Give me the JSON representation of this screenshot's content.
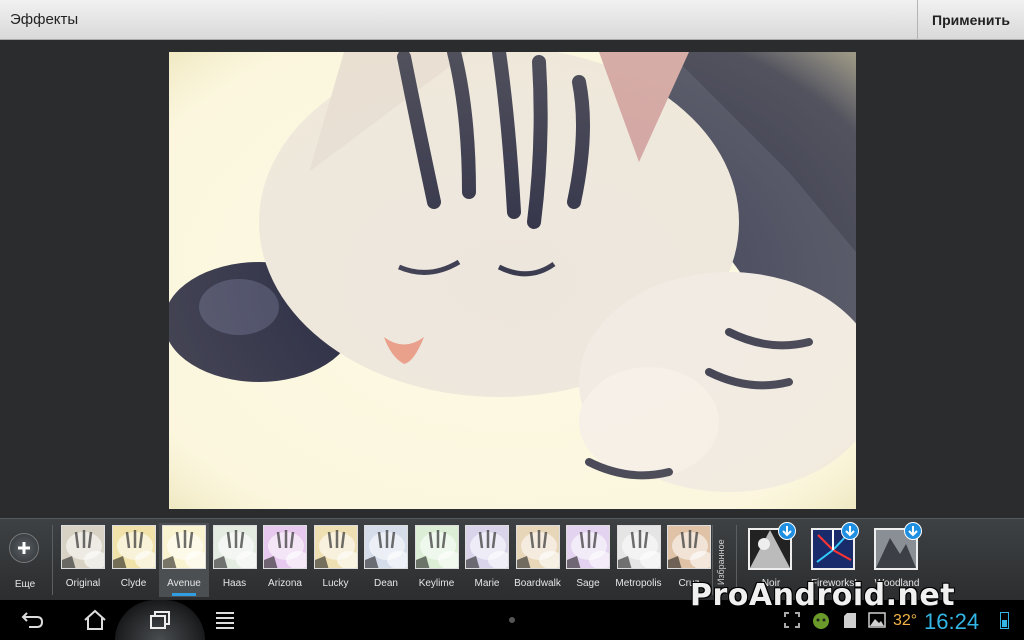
{
  "header": {
    "title": "Эффекты",
    "apply_label": "Применить"
  },
  "editor": {
    "photo_subject": "sleeping kitten with Avenue effect"
  },
  "effects": {
    "more_label": "Еще",
    "selected": "Avenue",
    "items": [
      {
        "label": "Original",
        "tint": "#d8d2c4"
      },
      {
        "label": "Clyde",
        "tint": "#f0e2a8"
      },
      {
        "label": "Avenue",
        "tint": "#faf3cf"
      },
      {
        "label": "Haas",
        "tint": "#e4ece2"
      },
      {
        "label": "Arizona",
        "tint": "#e7c8ee"
      },
      {
        "label": "Lucky",
        "tint": "#efe0b4"
      },
      {
        "label": "Dean",
        "tint": "#d5dcea"
      },
      {
        "label": "Keylime",
        "tint": "#dcefd6"
      },
      {
        "label": "Marie",
        "tint": "#d9d4ea"
      },
      {
        "label": "Boardwalk",
        "tint": "#e8d6b9"
      },
      {
        "label": "Sage",
        "tint": "#e3d3f0"
      },
      {
        "label": "Metropolis",
        "tint": "#e5e5e5"
      },
      {
        "label": "Cruz",
        "tint": "#e0c3a6"
      }
    ],
    "favorites_label": "Избранное",
    "downloadable": [
      {
        "label": "Noir",
        "icon": "noir-thumb"
      },
      {
        "label": "Fireworks!",
        "icon": "fireworks-thumb"
      },
      {
        "label": "Woodland",
        "icon": "woodland-thumb"
      }
    ]
  },
  "statusbar": {
    "watermark": "ProAndroid.net",
    "temperature": "32°",
    "time": "16:24"
  },
  "colors": {
    "accent": "#33b5e5",
    "selection": "#2f9de0",
    "temperature": "#f2b347"
  }
}
